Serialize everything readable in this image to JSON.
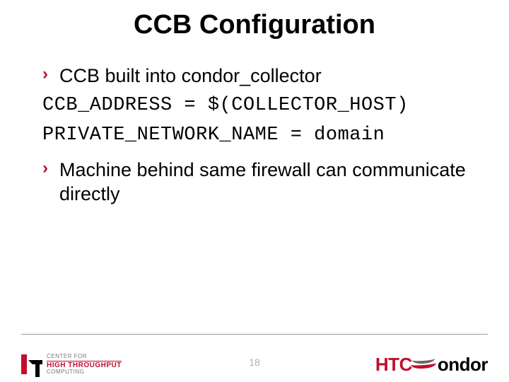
{
  "title": "CCB Configuration",
  "bullets": [
    "CCB built into condor_collector",
    "Machine behind same firewall can communicate directly"
  ],
  "code_lines": [
    "CCB_ADDRESS = $(COLLECTOR_HOST)",
    "PRIVATE_NETWORK_NAME = domain"
  ],
  "page_number": "18",
  "left_logo": {
    "line1": "CENTER FOR",
    "line2": "HIGH THROUGHPUT",
    "line3": "COMPUTING"
  },
  "right_logo": {
    "part1": "HTC",
    "part2": "ondor"
  },
  "colors": {
    "accent": "#c30d2e"
  }
}
